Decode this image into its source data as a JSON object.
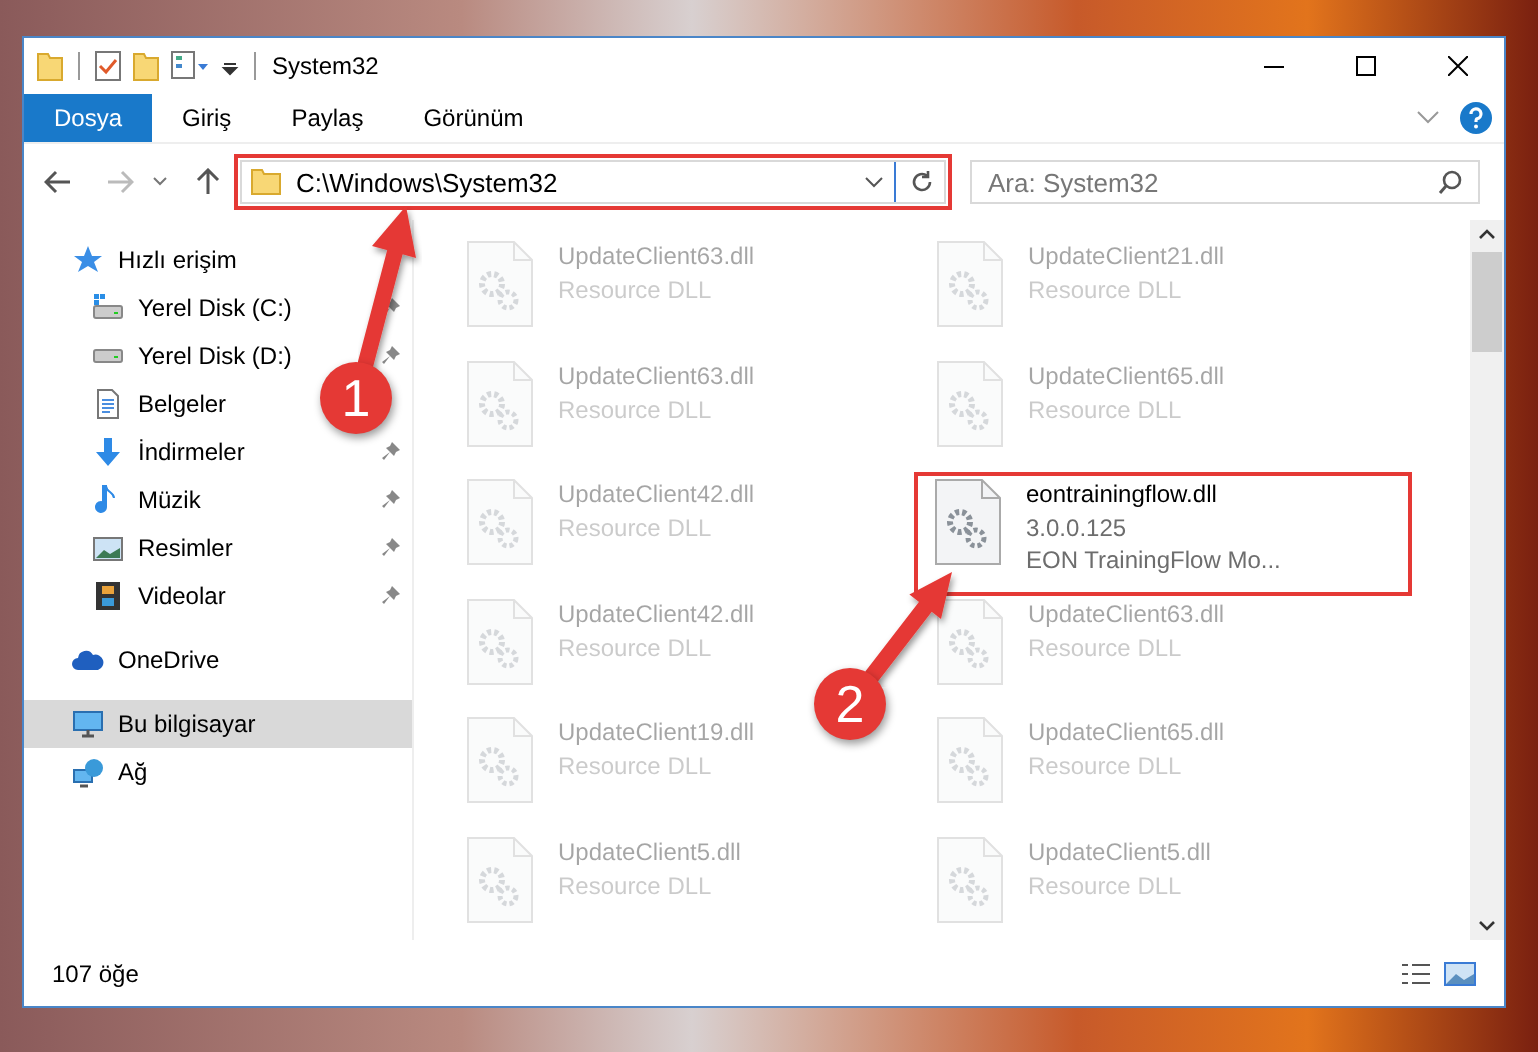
{
  "window": {
    "title": "System32"
  },
  "ribbon_tabs": [
    {
      "label": "Dosya",
      "selected": true
    },
    {
      "label": "Giriş",
      "selected": false
    },
    {
      "label": "Paylaş",
      "selected": false
    },
    {
      "label": "Görünüm",
      "selected": false
    }
  ],
  "address_bar": {
    "path": "C:\\Windows\\System32",
    "marked": true
  },
  "search": {
    "placeholder": "Ara: System32"
  },
  "navigation": [
    {
      "label": "Hızlı erişim",
      "kind": "star",
      "selected": false,
      "children": [
        {
          "label": "Yerel Disk (C:)",
          "kind": "drive-c",
          "pinned": true
        },
        {
          "label": "Yerel Disk (D:)",
          "kind": "drive",
          "pinned": true
        },
        {
          "label": "Belgeler",
          "kind": "documents",
          "pinned": false
        },
        {
          "label": "İndirmeler",
          "kind": "download",
          "pinned": true
        },
        {
          "label": "Müzik",
          "kind": "music",
          "pinned": true
        },
        {
          "label": "Resimler",
          "kind": "pictures",
          "pinned": true
        },
        {
          "label": "Videolar",
          "kind": "videos",
          "pinned": true
        }
      ]
    },
    {
      "label": "OneDrive",
      "kind": "cloud",
      "selected": false
    },
    {
      "label": "Bu bilgisayar",
      "kind": "computer",
      "selected": true
    },
    {
      "label": "Ağ",
      "kind": "network",
      "selected": false
    }
  ],
  "files": [
    {
      "name": "UpdateClient63.dll",
      "details": [
        "Resource DLL"
      ],
      "blurred": true,
      "marked": false
    },
    {
      "name": "UpdateClient21.dll",
      "details": [
        "Resource DLL"
      ],
      "blurred": true,
      "marked": false
    },
    {
      "name": "UpdateClient63.dll",
      "details": [
        "Resource DLL"
      ],
      "blurred": true,
      "marked": false
    },
    {
      "name": "UpdateClient65.dll",
      "details": [
        "Resource DLL"
      ],
      "blurred": true,
      "marked": false
    },
    {
      "name": "UpdateClient42.dll",
      "details": [
        "Resource DLL"
      ],
      "blurred": true,
      "marked": false
    },
    {
      "name": "eontrainingflow.dll",
      "details": [
        "3.0.0.125",
        "EON TrainingFlow Mo..."
      ],
      "blurred": false,
      "marked": true
    },
    {
      "name": "UpdateClient42.dll",
      "details": [
        "Resource DLL"
      ],
      "blurred": true,
      "marked": false
    },
    {
      "name": "UpdateClient63.dll",
      "details": [
        "Resource DLL"
      ],
      "blurred": true,
      "marked": false
    },
    {
      "name": "UpdateClient19.dll",
      "details": [
        "Resource DLL"
      ],
      "blurred": true,
      "marked": false
    },
    {
      "name": "UpdateClient65.dll",
      "details": [
        "Resource DLL"
      ],
      "blurred": true,
      "marked": false
    },
    {
      "name": "UpdateClient5.dll",
      "details": [
        "Resource DLL"
      ],
      "blurred": true,
      "marked": false
    },
    {
      "name": "UpdateClient5.dll",
      "details": [
        "Resource DLL"
      ],
      "blurred": true,
      "marked": false
    }
  ],
  "status_bar": {
    "item_count": "107 öğe"
  },
  "callouts": [
    {
      "number": "1"
    },
    {
      "number": "2"
    }
  ]
}
